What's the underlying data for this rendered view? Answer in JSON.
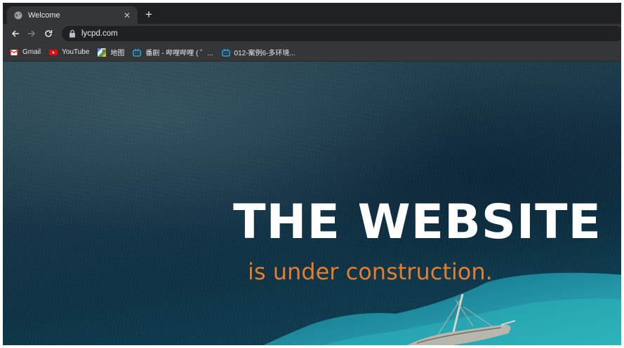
{
  "browser": {
    "tab": {
      "title": "Welcome",
      "favicon": "globe-icon",
      "close_glyph": "✕"
    },
    "new_tab_glyph": "+",
    "nav": {
      "back": "back-arrow-icon",
      "forward": "forward-arrow-icon",
      "reload": "reload-icon"
    },
    "omnibox": {
      "url": "lycpd.com",
      "lock_icon": "lock-icon"
    },
    "bookmarks": [
      {
        "label": "Gmail",
        "icon": "gmail-icon"
      },
      {
        "label": "YouTube",
        "icon": "youtube-icon"
      },
      {
        "label": "地图",
        "icon": "maps-icon"
      },
      {
        "label": "番剧 - 哔哩哔哩 ( ゜...",
        "icon": "bilibili-icon"
      },
      {
        "label": "012-案例6-多环境...",
        "icon": "bilibili-icon"
      }
    ]
  },
  "page": {
    "headline": "THE WEBSITE",
    "subheadline": "is under construction."
  },
  "colors": {
    "headline": "#ffffff",
    "subheadline": "#e57d2e",
    "chrome_dark": "#202124",
    "chrome_toolbar": "#35363a",
    "water_deep": "#0f3346",
    "water_shallow": "#2bb3b9"
  }
}
